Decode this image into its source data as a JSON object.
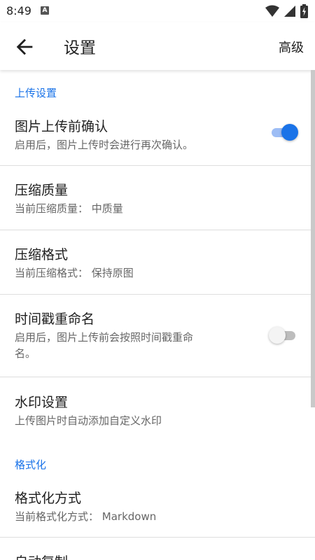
{
  "status_bar": {
    "time": "8:49",
    "notification_letter": "A"
  },
  "app_bar": {
    "title": "设置",
    "action_label": "高级"
  },
  "sections": {
    "upload": {
      "header": "上传设置",
      "confirm": {
        "title": "图片上传前确认",
        "summary": "启用后，图片上传时会进行再次确认。",
        "enabled": true
      },
      "quality": {
        "title": "压缩质量",
        "summary": "当前压缩质量： 中质量"
      },
      "format": {
        "title": "压缩格式",
        "summary": "当前压缩格式： 保持原图"
      },
      "rename": {
        "title": "时间戳重命名",
        "summary_line1": "启用后，图片上传前会按照时间戳重命",
        "summary_line2": "名。",
        "enabled": false
      },
      "watermark": {
        "title": "水印设置",
        "summary": "上传图片时自动添加自定义水印"
      }
    },
    "formatting": {
      "header": "格式化",
      "method": {
        "title": "格式化方式",
        "summary": "当前格式化方式： Markdown"
      },
      "auto_copy": {
        "title": "自动复制"
      }
    }
  },
  "colors": {
    "accent": "#1a73e8",
    "toggle_on_track": "#9dbdf5",
    "toggle_off_track": "#bdbdbd"
  }
}
